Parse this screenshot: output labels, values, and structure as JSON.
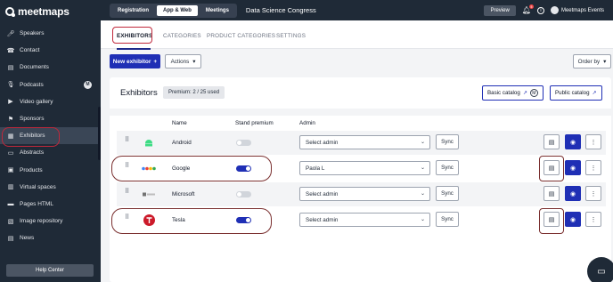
{
  "app": {
    "brand": "meetmaps",
    "event_name": "Data Science Congress"
  },
  "topbar": {
    "segments": [
      "Registration",
      "App & Web",
      "Meetings"
    ],
    "active_segment": "App & Web",
    "preview_label": "Preview",
    "notification_count": "5",
    "user_name": "Meetmaps Events"
  },
  "sidebar": {
    "items": [
      {
        "label": "Speakers",
        "icon": "microphone-icon"
      },
      {
        "label": "Contact",
        "icon": "phone-icon"
      },
      {
        "label": "Documents",
        "icon": "document-icon"
      },
      {
        "label": "Podcasts",
        "icon": "podcast-icon",
        "badge": "M"
      },
      {
        "label": "Video gallery",
        "icon": "video-icon"
      },
      {
        "label": "Sponsors",
        "icon": "flag-icon"
      },
      {
        "label": "Exhibitors",
        "icon": "store-icon",
        "active": true
      },
      {
        "label": "Abstracts",
        "icon": "abstract-icon"
      },
      {
        "label": "Products",
        "icon": "box-icon"
      },
      {
        "label": "Virtual spaces",
        "icon": "map-icon"
      },
      {
        "label": "Pages HTML",
        "icon": "html-icon"
      },
      {
        "label": "Image repository",
        "icon": "image-icon"
      },
      {
        "label": "News",
        "icon": "news-icon"
      }
    ],
    "help_label": "Help Center"
  },
  "tabs": [
    "EXHIBITORS",
    "CATEGORIES",
    "PRODUCT CATEGORIES",
    "SETTINGS"
  ],
  "toolbar": {
    "new_label": "New exhibitor",
    "actions_label": "Actions",
    "order_label": "Order by"
  },
  "card": {
    "title": "Exhibitors",
    "premium_label": "Premium: 2 / 25 used",
    "basic_catalog": "Basic catalog",
    "basic_badge": "M",
    "public_catalog": "Public catalog"
  },
  "table": {
    "headers": {
      "name": "Name",
      "stand": "Stand premium",
      "admin": "Admin"
    },
    "sync_label": "Sync",
    "rows": [
      {
        "name": "Android",
        "premium": false,
        "admin": "Select admin",
        "logo": "android-logo"
      },
      {
        "name": "Google",
        "premium": true,
        "admin": "Paola L",
        "logo": "google-logo"
      },
      {
        "name": "Microsoft",
        "premium": false,
        "admin": "Select admin",
        "logo": "microsoft-logo"
      },
      {
        "name": "Tesla",
        "premium": true,
        "admin": "Select admin",
        "logo": "tesla-logo"
      }
    ]
  },
  "colors": {
    "sidebar": "#1f2a37",
    "accent": "#1f2fb5",
    "annotation": "#c0283b"
  }
}
